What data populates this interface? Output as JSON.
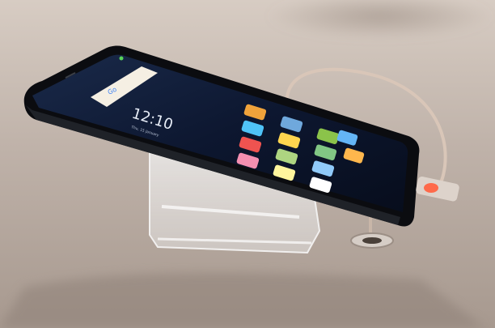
{
  "phone": {
    "clock_time": "12:10",
    "clock_date": "Thu, 15 January"
  },
  "colors": {
    "table": "#b8aca4",
    "screen": "#0e1a2e",
    "cable": "#d9c6b8",
    "indicator_led": "#ff6a4a"
  },
  "icons": [
    "weather-icon",
    "settings-icon",
    "gallery-icon",
    "camera-icon",
    "calendar-icon",
    "messages-icon",
    "notes-icon",
    "security-icon",
    "apps-icon",
    "clock-icon",
    "phone-icon",
    "files-icon",
    "google-icon",
    "updater-icon"
  ]
}
